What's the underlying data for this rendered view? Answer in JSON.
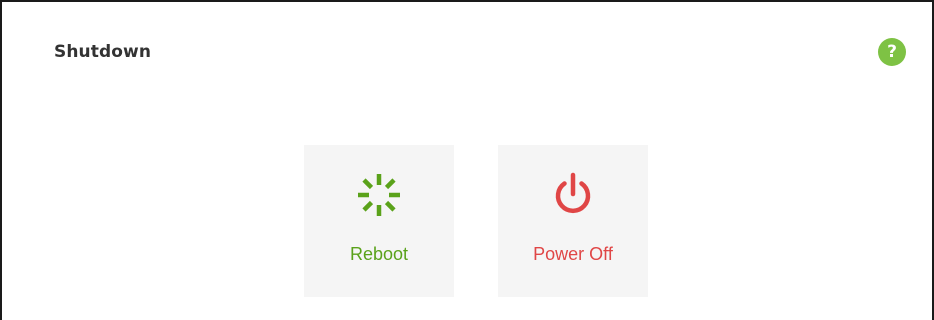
{
  "section": {
    "title": "Shutdown",
    "help_icon": "?",
    "help_icon_name": "help-icon"
  },
  "actions": [
    {
      "label": "Reboot",
      "icon": "reboot-spinner-icon",
      "color": "#5aa21a"
    },
    {
      "label": "Power Off",
      "icon": "power-icon",
      "color": "#e04646"
    }
  ],
  "colors": {
    "tile_background": "#f5f5f5",
    "help_icon_background": "#7ec244",
    "title_text": "#333333"
  }
}
